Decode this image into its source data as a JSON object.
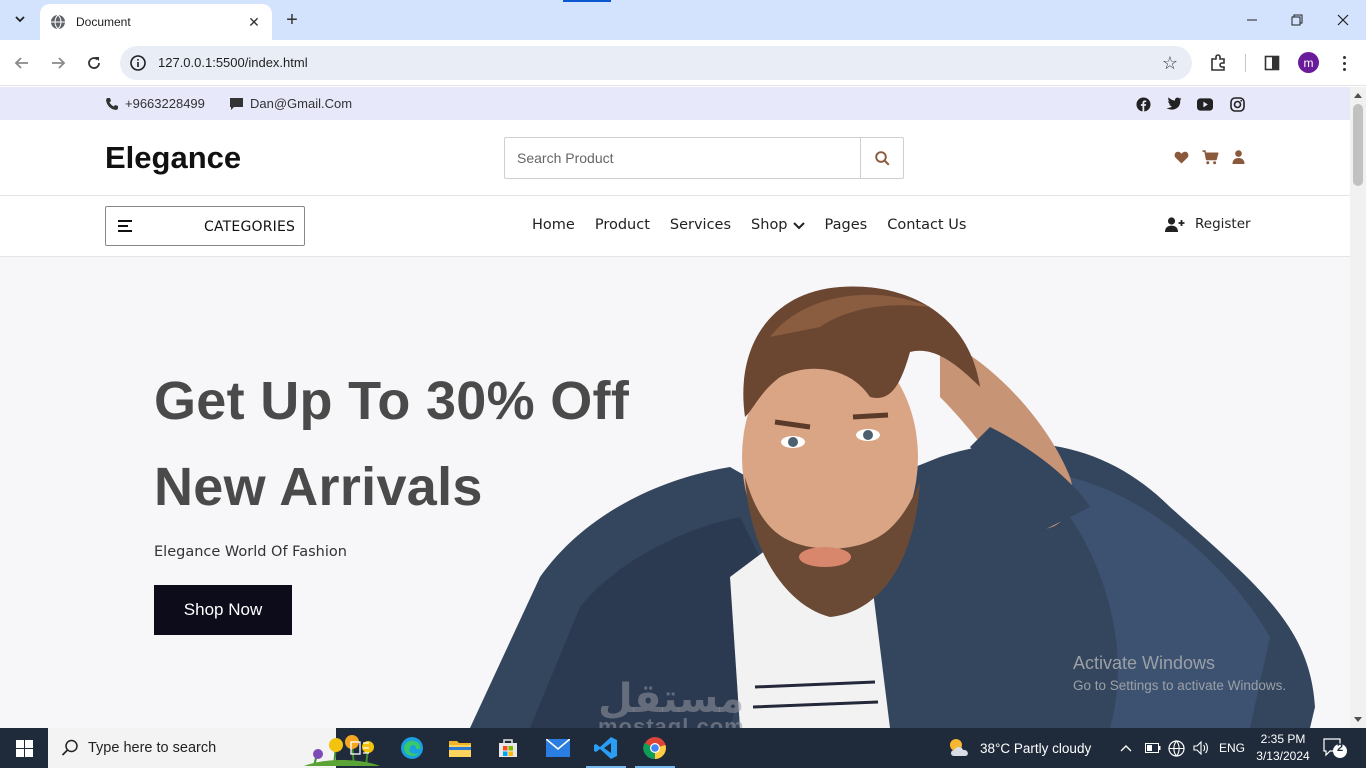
{
  "browser": {
    "tab_title": "Document",
    "url": "127.0.0.1:5500/index.html",
    "profile_initial": "m"
  },
  "topbar": {
    "phone": "+9663228499",
    "email": "Dan@Gmail.Com",
    "social_icons": [
      "facebook-icon",
      "twitter-icon",
      "youtube-icon",
      "instagram-icon"
    ]
  },
  "header": {
    "logo": "Elegance",
    "search_placeholder": "Search Product",
    "icons": [
      "heart-icon",
      "cart-icon",
      "user-icon"
    ]
  },
  "nav": {
    "categories_label": "CATEGORIES",
    "items": [
      "Home",
      "Product",
      "Services",
      "Shop",
      "Pages",
      "Contact Us"
    ],
    "register_label": "Register"
  },
  "hero": {
    "headline_1": "Get Up To 30% Off",
    "headline_2": "New Arrivals",
    "subtitle": "Elegance World Of Fashion",
    "cta": "Shop Now"
  },
  "overlay": {
    "activate_title": "Activate Windows",
    "activate_sub": "Go to Settings to activate Windows.",
    "watermark_ar": "مستقل",
    "watermark_en": "mostaql.com"
  },
  "taskbar": {
    "search_placeholder": "Type here to search",
    "weather": "38°C  Partly cloudy",
    "language": "ENG",
    "time": "2:35 PM",
    "date": "3/13/2024",
    "notifications": "2"
  },
  "colors": {
    "accent": "#8b5a3c",
    "topbar_bg": "#e8e8fb",
    "hero_bg": "#f7f7f9",
    "cta_bg": "#0c0c1a",
    "chrome_tab_bg": "#d3e3fd"
  }
}
